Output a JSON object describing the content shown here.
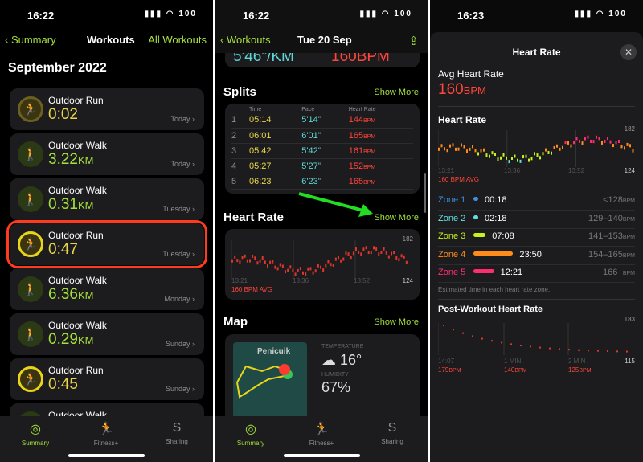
{
  "panel1": {
    "time": "16:22",
    "battery": "100",
    "back": "Summary",
    "title": "Workouts",
    "right": "All Workouts",
    "month": "September 2022",
    "workouts": [
      {
        "type": "Outdoor Run",
        "value": "0:02",
        "unit": "",
        "date": "Today",
        "icon": "run"
      },
      {
        "type": "Outdoor Walk",
        "value": "3.22",
        "unit": "KM",
        "date": "Today",
        "icon": "walk"
      },
      {
        "type": "Outdoor Walk",
        "value": "0.31",
        "unit": "KM",
        "date": "Tuesday",
        "icon": "walk"
      },
      {
        "type": "Outdoor Run",
        "value": "0:47",
        "unit": "",
        "date": "Tuesday",
        "icon": "run",
        "highlighted": true
      },
      {
        "type": "Outdoor Walk",
        "value": "6.36",
        "unit": "KM",
        "date": "Monday",
        "icon": "walk"
      },
      {
        "type": "Outdoor Walk",
        "value": "0.29",
        "unit": "KM",
        "date": "Sunday",
        "icon": "walk"
      },
      {
        "type": "Outdoor Run",
        "value": "0:45",
        "unit": "",
        "date": "Sunday",
        "icon": "run"
      },
      {
        "type": "Outdoor Walk",
        "value": "",
        "unit": "",
        "date": "",
        "icon": "walk"
      }
    ],
    "tabs": [
      "Summary",
      "Fitness+",
      "Sharing"
    ]
  },
  "panel2": {
    "time": "16:22",
    "back": "Workouts",
    "title": "Tue 20 Sep",
    "top_pace": "5'46\"/KM",
    "top_hr": "160BPM",
    "splits_title": "Splits",
    "show_more": "Show More",
    "split_headers": [
      "Time",
      "Pace",
      "Heart Rate"
    ],
    "splits": [
      [
        "1",
        "05:14",
        "5'14''",
        "144"
      ],
      [
        "2",
        "06:01",
        "6'01''",
        "165"
      ],
      [
        "3",
        "05:42",
        "5'42''",
        "161"
      ],
      [
        "4",
        "05:27",
        "5'27''",
        "152"
      ],
      [
        "5",
        "06:23",
        "6'23''",
        "165"
      ]
    ],
    "bpm_unit": "BPM",
    "hr_title": "Heart Rate",
    "hr_max": "182",
    "hr_min": "124",
    "hr_times": [
      "13:21",
      "13:36",
      "13:52"
    ],
    "hr_avg": "160 BPM AVG",
    "map_title": "Map",
    "map_place": "Penicuik",
    "temp_label": "TEMPERATURE",
    "temp": "16°",
    "humidity_label": "HUMIDITY",
    "humidity": "67%",
    "tabs": [
      "Summary",
      "Fitness+",
      "Sharing"
    ]
  },
  "panel3": {
    "time": "16:23",
    "title": "Heart Rate",
    "avg_label": "Avg Heart Rate",
    "avg_value": "160",
    "avg_unit": "BPM",
    "hr_title": "Heart Rate",
    "hr_max": "182",
    "hr_min": "124",
    "hr_times": [
      "13:21",
      "13:36",
      "13:52"
    ],
    "hr_avg": "160 BPM AVG",
    "zones": [
      {
        "name": "Zone 1",
        "time": "00:18",
        "range": "<128",
        "color": "#3f8fe0",
        "fraction": 0.01
      },
      {
        "name": "Zone 2",
        "time": "02:18",
        "range": "129–140",
        "color": "#5fe0e0",
        "fraction": 0.05
      },
      {
        "name": "Zone 3",
        "time": "07:08",
        "range": "141–153",
        "color": "#c6f21e",
        "fraction": 0.16
      },
      {
        "name": "Zone 4",
        "time": "23:50",
        "range": "154–165",
        "color": "#ff8c1a",
        "fraction": 0.52
      },
      {
        "name": "Zone 5",
        "time": "12:21",
        "range": "166+",
        "color": "#ff2d6f",
        "fraction": 0.27
      }
    ],
    "zone_note": "Estimated time in each heart rate zone.",
    "post_title": "Post-Workout Heart Rate",
    "post_max": "183",
    "post_min": "115",
    "post_times": [
      "14:07",
      "1 MIN",
      "2 MIN"
    ],
    "post_values": [
      "179",
      "140",
      "125"
    ],
    "bpm_unit": "BPM"
  },
  "colors": {
    "accent": "#a4e13c",
    "highlight": "#ff3b1f",
    "arrow": "#22dd22"
  }
}
